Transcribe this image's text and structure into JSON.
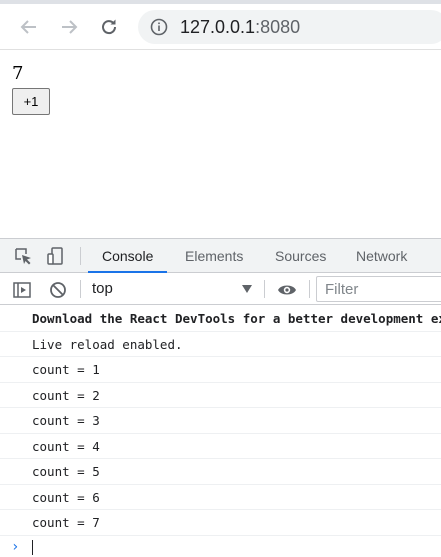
{
  "browser": {
    "url_host": "127.0.0.1",
    "url_port": ":8080",
    "icons": {
      "back": "arrow-left-icon",
      "forward": "arrow-right-icon",
      "reload": "reload-icon",
      "site_info": "info-icon"
    }
  },
  "page": {
    "count_value": "7",
    "increment_label": "+1"
  },
  "devtools": {
    "tabs": [
      {
        "label": "Console",
        "active": true
      },
      {
        "label": "Elements",
        "active": false
      },
      {
        "label": "Sources",
        "active": false
      },
      {
        "label": "Network",
        "active": false
      }
    ],
    "tool_icons": [
      "inspect-element-icon",
      "device-toolbar-icon"
    ],
    "console": {
      "context": "top",
      "filter_placeholder": "Filter",
      "toolbar_icons": [
        "sidebar-toggle-icon",
        "clear-console-icon",
        "live-expression-eye-icon"
      ],
      "messages": [
        {
          "text": "Download the React DevTools for a better development experience",
          "bold": true
        },
        {
          "text": "Live reload enabled.",
          "bold": false
        },
        {
          "text": "count = 1",
          "bold": false
        },
        {
          "text": "count = 2",
          "bold": false
        },
        {
          "text": "count = 3",
          "bold": false
        },
        {
          "text": "count = 4",
          "bold": false
        },
        {
          "text": "count = 5",
          "bold": false
        },
        {
          "text": "count = 6",
          "bold": false
        },
        {
          "text": "count = 7",
          "bold": false
        }
      ],
      "prompt_symbol": "›"
    }
  },
  "colors": {
    "accent": "#1a73e8",
    "toolbar_bg": "#f1f3f4"
  }
}
